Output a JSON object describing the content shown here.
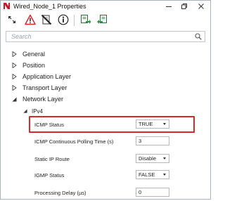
{
  "window": {
    "title": "Wired_Node_1 Properties",
    "controls": {
      "minimize": "—",
      "maximize": "❐",
      "close": "✕"
    }
  },
  "toolbar": {
    "icons": [
      "expand-arrows-icon",
      "warning-icon",
      "disable-icon",
      "info-icon",
      "export-icon",
      "import-icon"
    ]
  },
  "search": {
    "placeholder": "Search",
    "value": ""
  },
  "tree": {
    "items": [
      {
        "label": "General",
        "expanded": false
      },
      {
        "label": "Position",
        "expanded": false
      },
      {
        "label": "Application Layer",
        "expanded": false
      },
      {
        "label": "Transport Layer",
        "expanded": false
      },
      {
        "label": "Network Layer",
        "expanded": true
      }
    ],
    "subgroup": {
      "label": "IPv4",
      "expanded": true
    }
  },
  "properties": [
    {
      "label": "ICMP Status",
      "value": "TRUE",
      "type": "dropdown",
      "highlighted": true
    },
    {
      "label": "ICMP Continuous Polling Time (s)",
      "value": "3",
      "type": "text"
    },
    {
      "label": "Static IP Route",
      "value": "Disable",
      "type": "dropdown"
    },
    {
      "label": "IGMP Status",
      "value": "FALSE",
      "type": "dropdown"
    },
    {
      "label": "Processing Delay (µs)",
      "value": "0",
      "type": "text"
    }
  ],
  "colors": {
    "highlight": "#d9272e",
    "border": "#b5b9be",
    "accent": "#2c7bd6"
  }
}
